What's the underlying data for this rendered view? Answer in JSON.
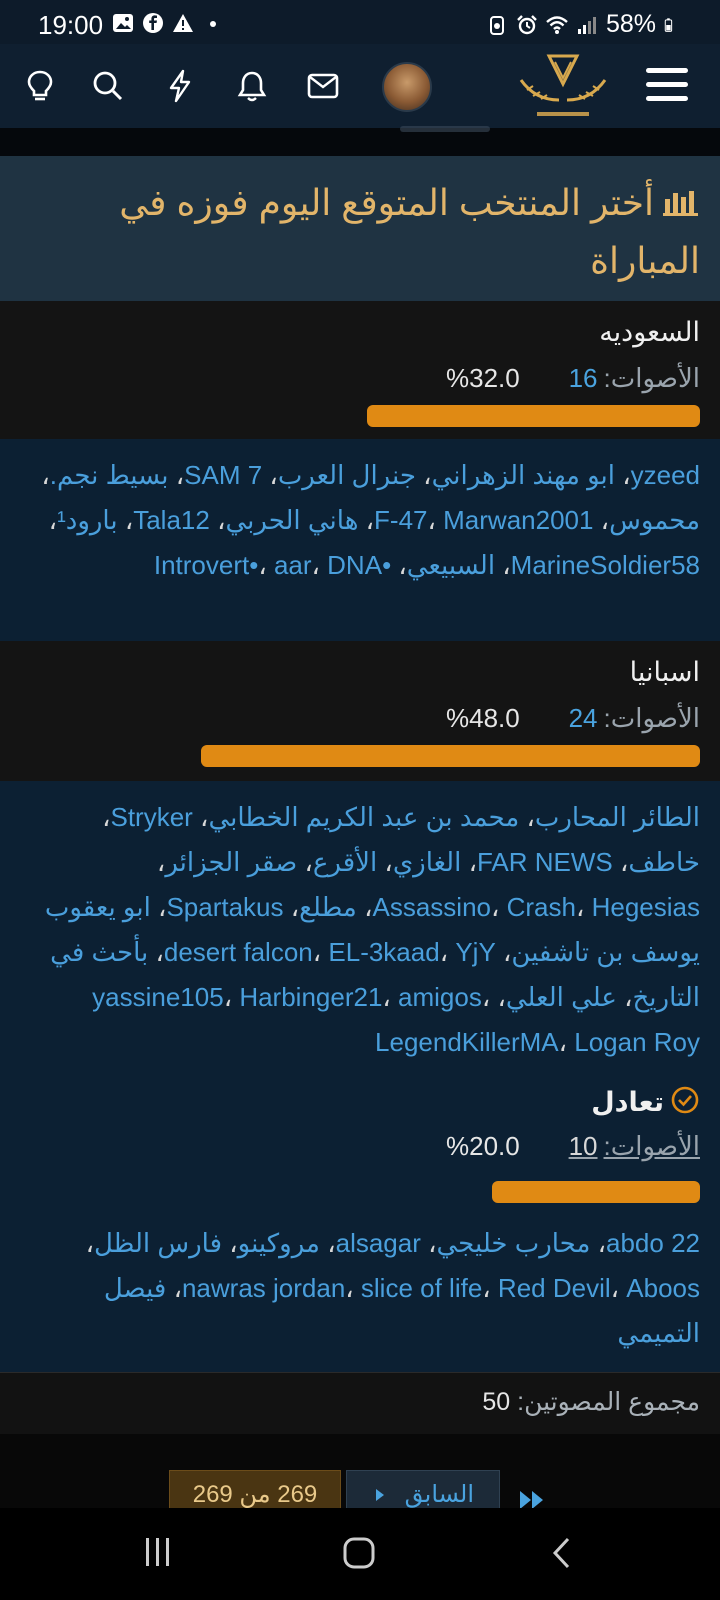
{
  "status_bar": {
    "time": "19:00",
    "battery": "58%"
  },
  "poll": {
    "title": "أختر المنتخب المتوقع اليوم فوزه في المباراة",
    "votes_label": "الأصوات:",
    "options": [
      {
        "name": "السعوديه",
        "votes": "16",
        "percent": "%32.0",
        "fraction": 0.32,
        "winner": false,
        "voters": [
          "yzeed",
          "ابو مهند الزهراني",
          "جنرال العرب",
          "SAM 7",
          "بسيط نجم.",
          "محموس",
          "F-47",
          "Marwan2001",
          "هاني الحربي",
          "Tala12",
          "بارود¹",
          "MarineSoldier58",
          "السبيعي",
          "•Introvert•",
          "aar",
          "DNA"
        ]
      },
      {
        "name": "اسبانيا",
        "votes": "24",
        "percent": "%48.0",
        "fraction": 0.48,
        "winner": false,
        "voters": [
          "الطائر المحارب",
          "محمد بن عبد الكريم الخطابي",
          "Stryker",
          "خاطف",
          "FAR NEWS",
          "الغازي",
          "الأقرع",
          "صقر الجزائر",
          "Assassino",
          "Crash",
          "Hegesias",
          "مطلع",
          "Spartakus",
          "ابو يعقوب يوسف بن تاشفين",
          "desert falcon",
          "EL-3kaad",
          "YjY",
          "بأحث في التاريخ",
          "علي العلي",
          "yassine105",
          "Harbinger21",
          "amigos",
          "LegendKillerMA",
          "Logan Roy"
        ]
      },
      {
        "name": "تعادل",
        "votes": "10",
        "percent": "%20.0",
        "fraction": 0.2,
        "winner": true,
        "voters": [
          "abdo 22",
          "محارب خليجي",
          "alsagar",
          "مروكينو",
          "فارس الظل",
          "nawras jordan",
          "slice of life",
          "Red Devil",
          "Aboos",
          "فيصل التميمي"
        ]
      }
    ],
    "total_label": "مجموع المصوتين:",
    "total_value": "50"
  },
  "pagination": {
    "page_text": "269 من 269",
    "prev_label": "السابق"
  },
  "colors": {
    "accent_gold": "#e2b56a",
    "bar_orange": "#e08a14",
    "link_blue": "#4a9fdc"
  }
}
